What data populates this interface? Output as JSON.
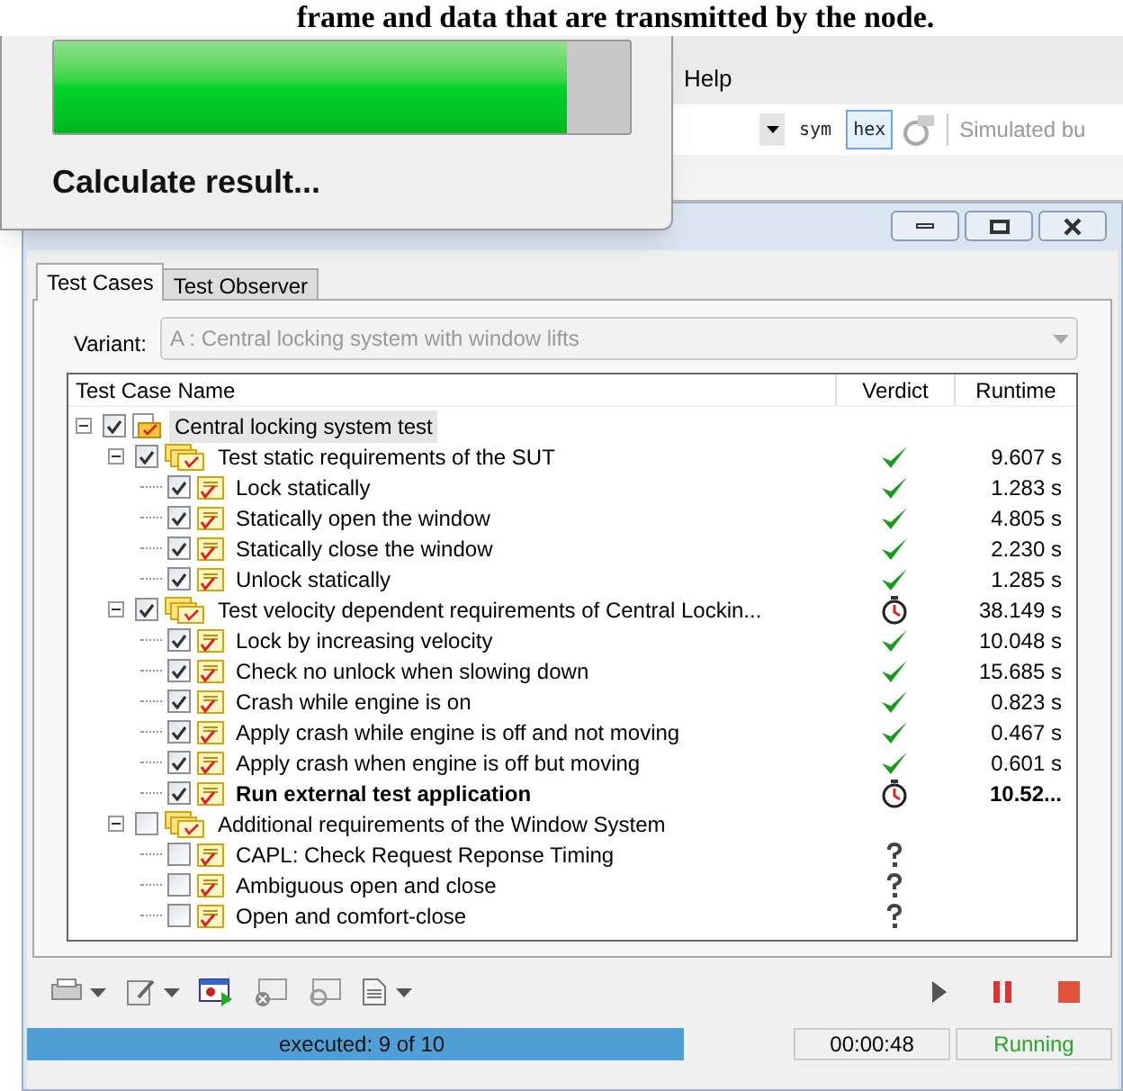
{
  "caption": "frame and data that are transmitted by the node.",
  "background_window": {
    "menu": [
      "Help"
    ],
    "toolbar": [
      {
        "kind": "dropdown"
      },
      {
        "kind": "toggle",
        "label": "sym",
        "selected": false
      },
      {
        "kind": "toggle",
        "label": "hex",
        "selected": true
      },
      {
        "kind": "icon"
      },
      {
        "kind": "text",
        "label": "Simulated bu"
      }
    ]
  },
  "progress_dialog": {
    "level": 0.89,
    "message": "Calculate result..."
  },
  "tester": {
    "tabs": [
      {
        "label": "Test Cases",
        "selected": true
      },
      {
        "label": "Test Observer",
        "selected": false
      }
    ],
    "variant": {
      "label": "Variant:",
      "value": "A : Central locking system with window lifts",
      "disabled": true
    },
    "columns": [
      "Test Case Name",
      "Verdict",
      "Runtime"
    ],
    "tree": [
      {
        "kind": "root",
        "name": "Central locking system test",
        "checked": true,
        "selected": true,
        "expanded": true,
        "bold": false,
        "children": [
          {
            "kind": "group",
            "name": "Test static requirements of the SUT",
            "checked": true,
            "selected": false,
            "expanded": true,
            "bold": false,
            "verdict": {
              "kind": "pass"
            },
            "runtime": "9.607 s",
            "children": [
              {
                "kind": "test",
                "name": "Lock statically",
                "checked": true,
                "selected": false,
                "bold": false,
                "verdict": {
                  "kind": "pass"
                },
                "runtime": "1.283 s"
              },
              {
                "kind": "test",
                "name": "Statically open the window",
                "checked": true,
                "selected": false,
                "bold": false,
                "verdict": {
                  "kind": "pass"
                },
                "runtime": "4.805 s"
              },
              {
                "kind": "test",
                "name": "Statically close the window",
                "checked": true,
                "selected": false,
                "bold": false,
                "verdict": {
                  "kind": "pass"
                },
                "runtime": "2.230 s"
              },
              {
                "kind": "test",
                "name": "Unlock statically",
                "checked": true,
                "selected": false,
                "bold": false,
                "verdict": {
                  "kind": "pass"
                },
                "runtime": "1.285 s"
              }
            ]
          },
          {
            "kind": "group",
            "name": "Test velocity dependent requirements of Central Lockin...",
            "checked": true,
            "selected": false,
            "expanded": true,
            "bold": false,
            "verdict": {
              "kind": "running"
            },
            "runtime": "38.149 s",
            "children": [
              {
                "kind": "test",
                "name": "Lock by increasing velocity",
                "checked": true,
                "selected": false,
                "bold": false,
                "verdict": {
                  "kind": "pass"
                },
                "runtime": "10.048 s"
              },
              {
                "kind": "test",
                "name": "Check no unlock when slowing down",
                "checked": true,
                "selected": false,
                "bold": false,
                "verdict": {
                  "kind": "pass"
                },
                "runtime": "15.685 s"
              },
              {
                "kind": "test",
                "name": "Crash while engine is on",
                "checked": true,
                "selected": false,
                "bold": false,
                "verdict": {
                  "kind": "pass"
                },
                "runtime": "0.823 s"
              },
              {
                "kind": "test",
                "name": "Apply crash while engine is off and not moving",
                "checked": true,
                "selected": false,
                "bold": false,
                "verdict": {
                  "kind": "pass"
                },
                "runtime": "0.467 s"
              },
              {
                "kind": "test",
                "name": "Apply crash when engine is off but moving",
                "checked": true,
                "selected": false,
                "bold": false,
                "verdict": {
                  "kind": "pass"
                },
                "runtime": "0.601 s"
              },
              {
                "kind": "test",
                "name": "Run external test application",
                "checked": true,
                "selected": false,
                "bold": true,
                "verdict": {
                  "kind": "running"
                },
                "runtime": "10.52..."
              }
            ]
          },
          {
            "kind": "group",
            "name": "Additional requirements of the Window System",
            "checked": false,
            "selected": false,
            "expanded": true,
            "bold": false,
            "children": [
              {
                "kind": "test",
                "name": "CAPL: Check Request Reponse Timing",
                "checked": false,
                "selected": false,
                "bold": false,
                "verdict": {
                  "kind": "unknown"
                }
              },
              {
                "kind": "test",
                "name": "Ambiguous open and close",
                "checked": false,
                "selected": false,
                "bold": false,
                "verdict": {
                  "kind": "unknown"
                }
              },
              {
                "kind": "test",
                "name": "Open and comfort-close",
                "checked": false,
                "selected": false,
                "bold": false,
                "verdict": {
                  "kind": "unknown"
                }
              }
            ]
          }
        ]
      }
    ],
    "status_bar": {
      "progress": {
        "level": 0.88,
        "label": "executed: 9 of 10"
      },
      "elapsed": "00:00:48",
      "state": "Running"
    }
  }
}
